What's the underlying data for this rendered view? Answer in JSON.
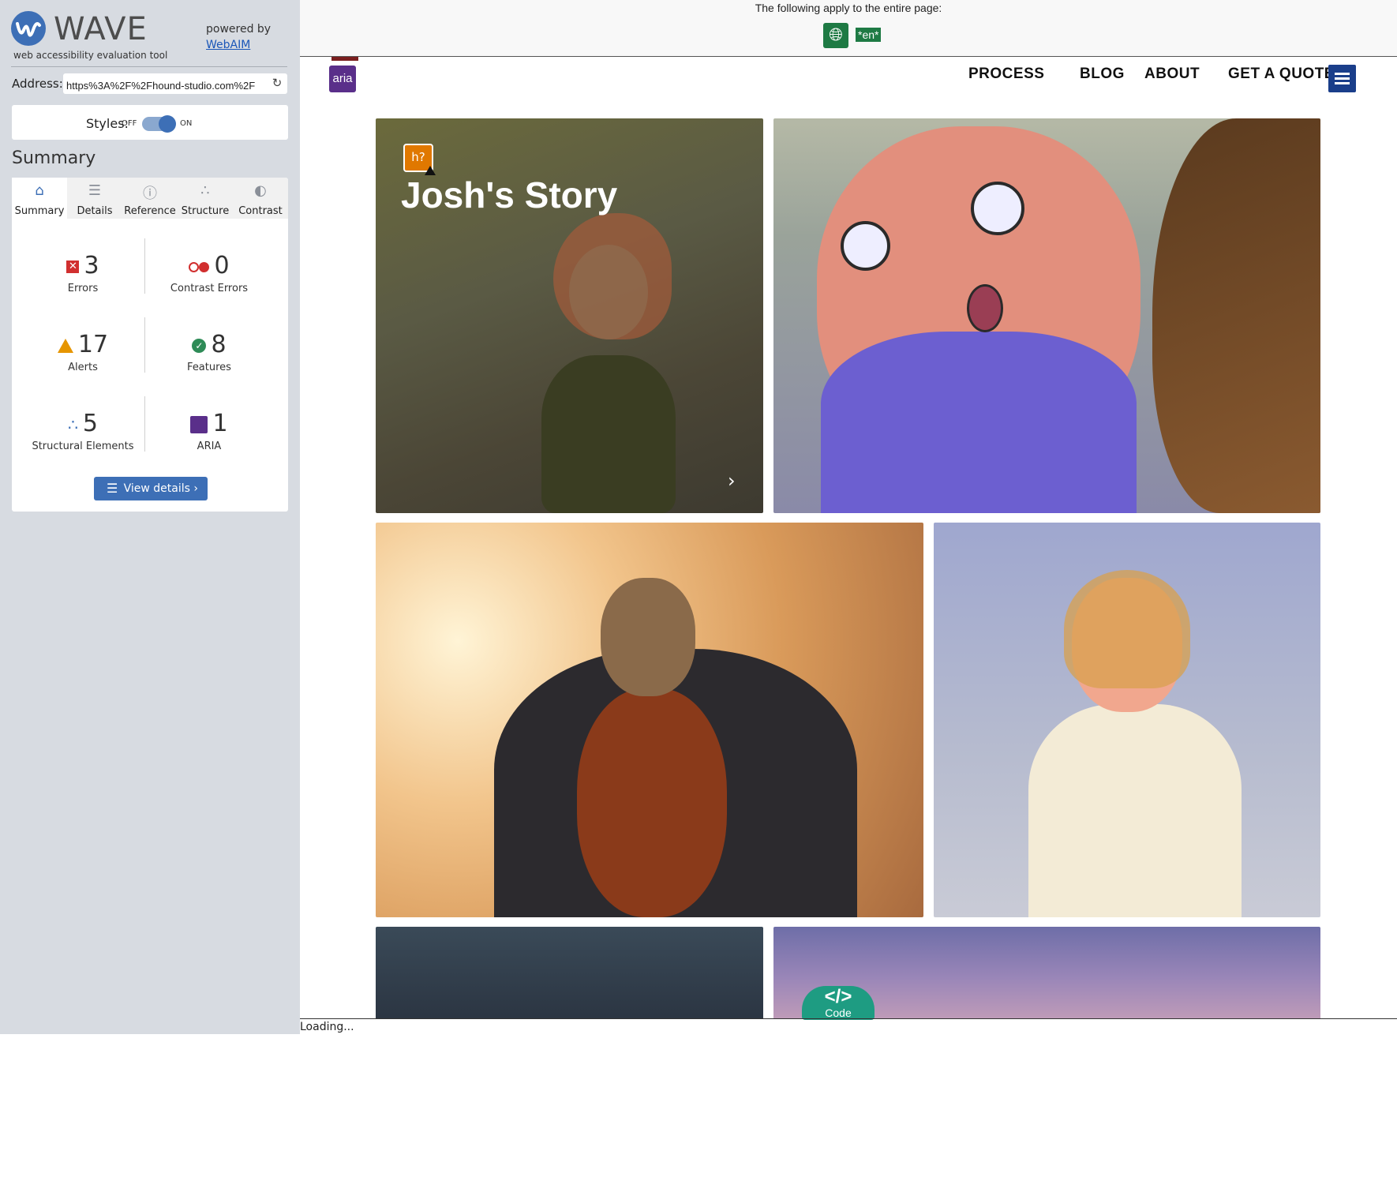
{
  "wave": {
    "name": "WAVE",
    "subtitle": "web accessibility evaluation tool",
    "powered_by": "powered by",
    "webaim_link": "WebAIM",
    "address_label": "Address:",
    "address_value": "https%3A%2F%2Fhound-studio.com%2F",
    "styles_label": "Styles:",
    "styles_off": "OFF",
    "styles_on": "ON",
    "styles_state": "on",
    "summary_heading": "Summary",
    "tabs": [
      {
        "label": "Summary",
        "icon": "home-icon",
        "active": true
      },
      {
        "label": "Details",
        "icon": "list-icon",
        "active": false
      },
      {
        "label": "Reference",
        "icon": "info-icon",
        "active": false
      },
      {
        "label": "Structure",
        "icon": "structure-icon",
        "active": false
      },
      {
        "label": "Contrast",
        "icon": "contrast-icon",
        "active": false
      }
    ],
    "stats": {
      "errors": {
        "count": "3",
        "label": "Errors",
        "color": "#d12f2f"
      },
      "contrast_errors": {
        "count": "0",
        "label": "Contrast Errors",
        "color": "#d12f2f"
      },
      "alerts": {
        "count": "17",
        "label": "Alerts",
        "color": "#e69500"
      },
      "features": {
        "count": "8",
        "label": "Features",
        "color": "#2e8b57"
      },
      "structural": {
        "count": "5",
        "label": "Structural Elements",
        "color": "#3d6fb6"
      },
      "aria": {
        "count": "1",
        "label": "ARIA",
        "color": "#5a2f8a"
      }
    },
    "view_details": "View details ›"
  },
  "banner": {
    "text": "The following apply to the entire page:",
    "lang_badge": "*en*",
    "globe_icon": "globe-icon"
  },
  "site": {
    "aria_badge": "aria",
    "nav": [
      "PROCESS",
      "BLOG",
      "ABOUT",
      "GET A QUOTE"
    ],
    "heading_badge": "h?",
    "story_title": "Josh's Story",
    "chevron": "›"
  },
  "code_button": {
    "symbol": "</>",
    "label": "Code"
  },
  "status": {
    "loading": "Loading..."
  },
  "colors": {
    "wave_blue": "#3d6fb6",
    "feature_green": "#1e7a44",
    "code_teal": "#1e9c82"
  }
}
